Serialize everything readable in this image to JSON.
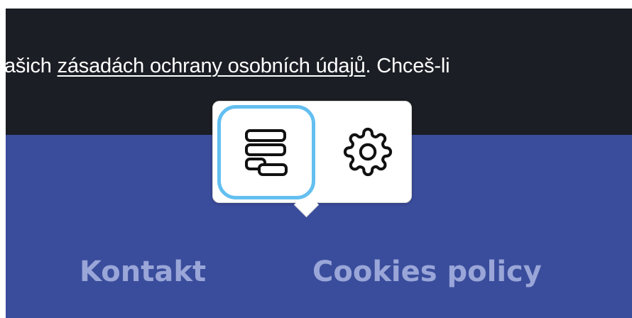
{
  "banner": {
    "text_before": "ašich ",
    "privacy_link": "zásadách ochrany osobních údajů",
    "text_after": ". Chceš-li"
  },
  "toolbar": {
    "buttons": [
      {
        "icon": "stacked-list-icon",
        "selected": true
      },
      {
        "icon": "gear-icon",
        "selected": false
      }
    ],
    "selected_color": "#63bff0"
  },
  "footer": {
    "links": [
      "Kontakt",
      "Cookies policy"
    ],
    "background_color": "#3a4d9c",
    "link_color": "#9aa6d8"
  },
  "banner_color": "#1b1e24"
}
